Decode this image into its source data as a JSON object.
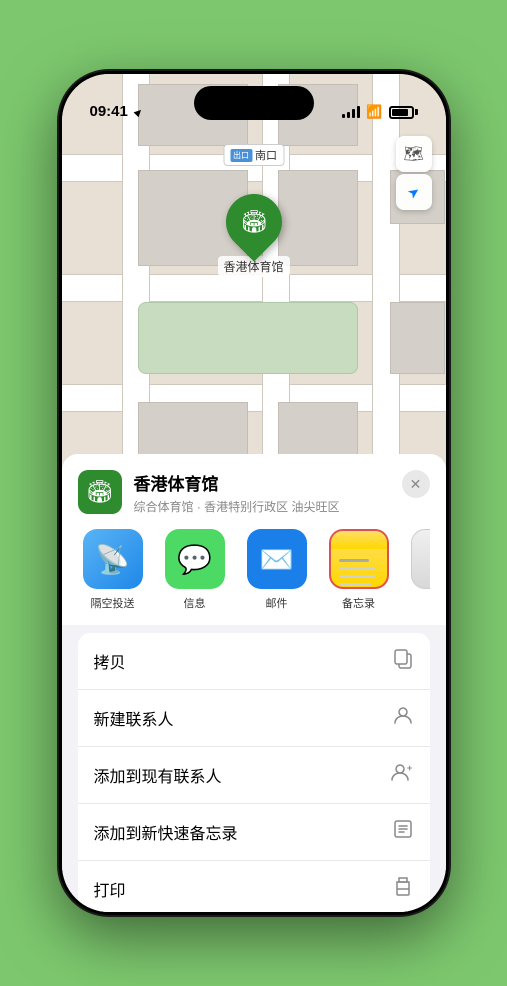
{
  "status_bar": {
    "time": "09:41",
    "location_arrow": "▲"
  },
  "map": {
    "label_prefix": "南口",
    "location_name": "香港体育馆",
    "pin_emoji": "🏟"
  },
  "map_controls": {
    "map_icon": "🗺",
    "location_icon": "➤"
  },
  "venue_card": {
    "name": "香港体育馆",
    "subtitle": "综合体育馆 · 香港特别行政区 油尖旺区",
    "close_icon": "✕"
  },
  "share_apps": [
    {
      "id": "airdrop",
      "label": "隔空投送",
      "type": "airdrop"
    },
    {
      "id": "messages",
      "label": "信息",
      "type": "messages"
    },
    {
      "id": "mail",
      "label": "邮件",
      "type": "mail"
    },
    {
      "id": "notes",
      "label": "备忘录",
      "type": "notes"
    },
    {
      "id": "more",
      "label": "提",
      "type": "more"
    }
  ],
  "actions": [
    {
      "id": "copy",
      "label": "拷贝",
      "icon": "⎘"
    },
    {
      "id": "new-contact",
      "label": "新建联系人",
      "icon": "👤"
    },
    {
      "id": "add-existing",
      "label": "添加到现有联系人",
      "icon": "👤"
    },
    {
      "id": "add-notes",
      "label": "添加到新快速备忘录",
      "icon": "📋"
    },
    {
      "id": "print",
      "label": "打印",
      "icon": "🖨"
    }
  ]
}
